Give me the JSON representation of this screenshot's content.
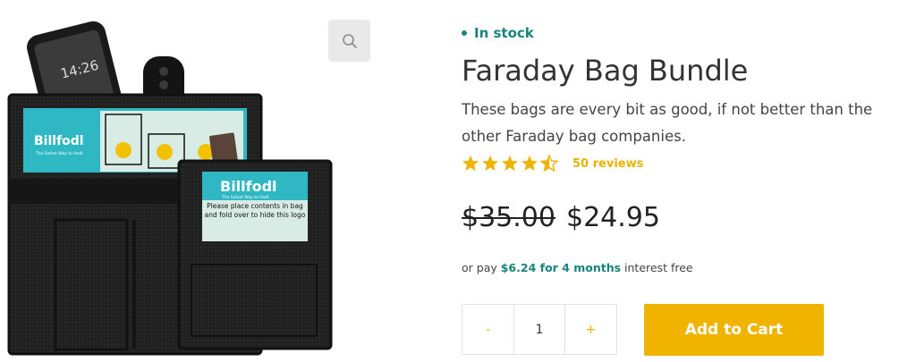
{
  "gallery": {
    "big_logo_text": "Billfodl",
    "big_logo_tagline": "The Safest Way to Hodl",
    "small_logo_text": "Billfodl",
    "small_logo_tagline": "The Safest Way to Hodl",
    "instructions": "Please place contents in bag and fold over to hide this logo",
    "phone_time": "14:26",
    "zoom_icon": "search-icon"
  },
  "product": {
    "stock_status": "In stock",
    "title": "Faraday Bag Bundle",
    "description": "These bags are every bit as good, if not better than the other Faraday bag companies.",
    "rating": 4.5,
    "reviews_label": "50 reviews",
    "old_price": "$35.00",
    "price": "$24.95",
    "installment": {
      "prefix": "or pay ",
      "amount_terms": "$6.24 for 4 months",
      "suffix": " interest free"
    }
  },
  "cart": {
    "minus_label": "-",
    "quantity": "1",
    "plus_label": "+",
    "add_label": "Add to Cart"
  },
  "colors": {
    "accent_teal": "#17847d",
    "accent_gold": "#f0b400",
    "bag_black": "#1c1c1c",
    "label_cyan": "#2fb8c3"
  }
}
